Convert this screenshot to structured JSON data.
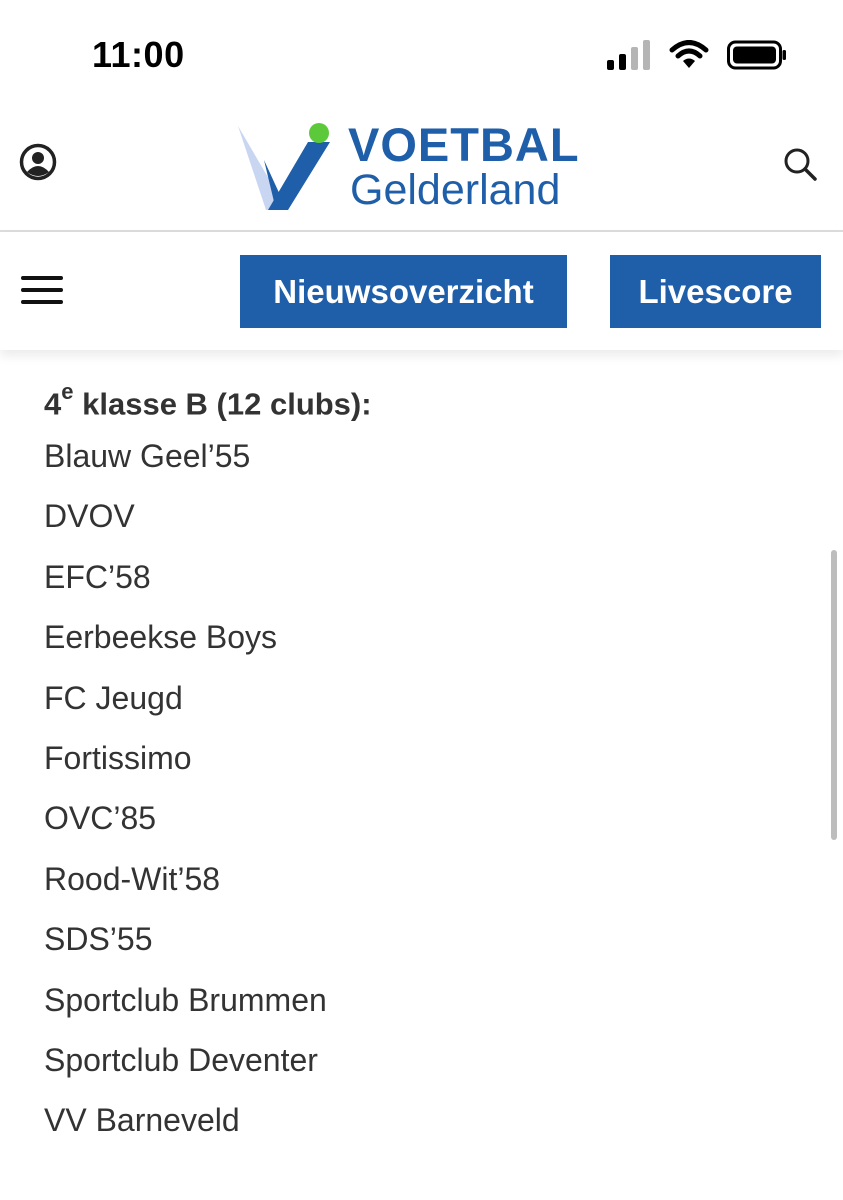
{
  "status_bar": {
    "time": "11:00"
  },
  "header": {
    "logo_line1": "VOETBAL",
    "logo_line2": "Gelderland",
    "user_icon": "user-icon",
    "search_icon": "search-icon"
  },
  "nav": {
    "menu_icon": "hamburger-menu-icon",
    "buttons": [
      {
        "label": "Nieuwsoverzicht"
      },
      {
        "label": "Livescore"
      }
    ]
  },
  "content": {
    "title_prefix": "4",
    "title_sup": "e",
    "title_rest": " klasse B (12 clubs):",
    "clubs": [
      "Blauw Geel’55",
      "DVOV",
      "EFC’58",
      "Eerbeekse Boys",
      "FC Jeugd",
      "Fortissimo",
      "OVC’85",
      "Rood-Wit’58",
      "SDS’55",
      "Sportclub Brummen",
      "Sportclub Deventer",
      "VV Barneveld"
    ]
  },
  "colors": {
    "brand_blue": "#1f5ea8",
    "logo_green": "#5cc93a"
  }
}
